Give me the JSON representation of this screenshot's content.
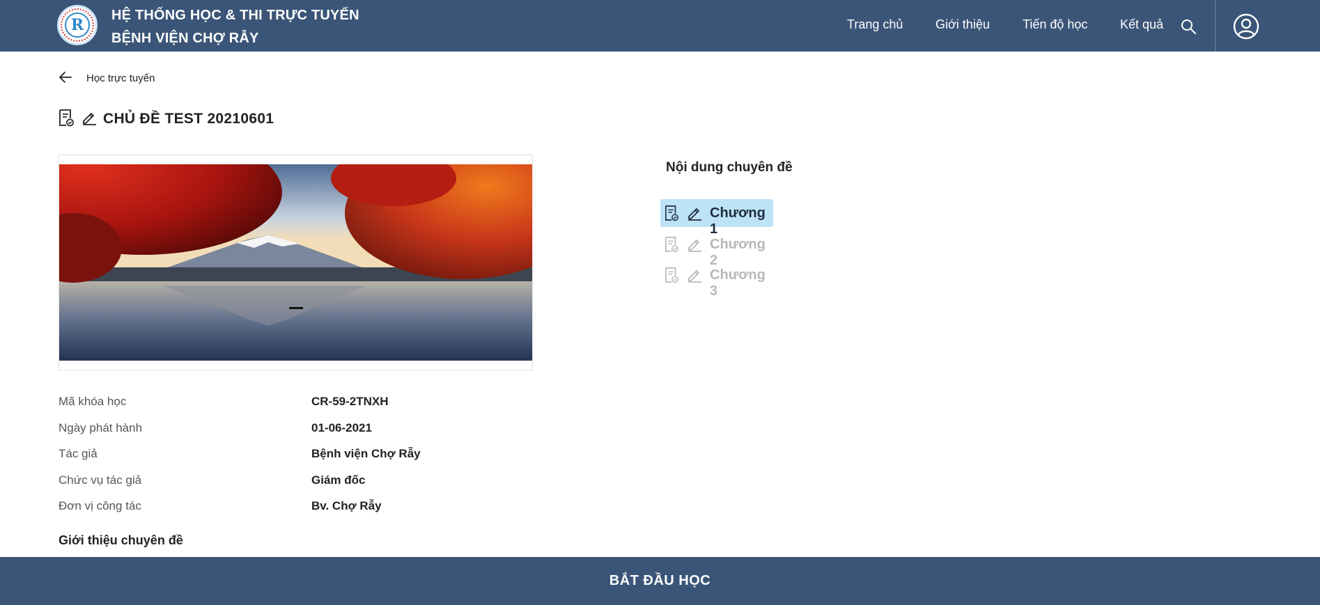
{
  "header": {
    "brand_line1": "HỆ THỐNG HỌC & THI TRỰC TUYẾN",
    "brand_line2": "BỆNH VIỆN CHỢ RẪY",
    "logo_letter": "R",
    "nav": [
      "Trang chủ",
      "Giới thiệu",
      "Tiến độ học",
      "Kết quả"
    ],
    "search_icon": "search-icon",
    "user_icon": "user-circle-icon"
  },
  "breadcrumb": {
    "label": "Học trực tuyến",
    "icon": "arrow-left-icon"
  },
  "course": {
    "title": "CHỦ ĐỀ TEST 20210601",
    "info": [
      {
        "label": "Mã khóa học",
        "value": "CR-59-2TNXH"
      },
      {
        "label": "Ngày phát hành",
        "value": "01-06-2021"
      },
      {
        "label": "Tác giả",
        "value": "Bệnh viện Chợ Rẫy"
      },
      {
        "label": "Chức vụ tác giả",
        "value": "Giám đốc"
      },
      {
        "label": "Đơn vị công tác",
        "value": "Bv. Chợ Rẫy"
      }
    ],
    "intro_heading": "Giới thiệu chuyên đề"
  },
  "content": {
    "heading": "Nội dung chuyên đề",
    "chapters": [
      {
        "label": "Chương 1",
        "state": "active"
      },
      {
        "label": "Chương 2",
        "state": "locked"
      },
      {
        "label": "Chương 3",
        "state": "locked"
      }
    ]
  },
  "footer": {
    "start_label": "BẮT ĐẦU HỌC"
  },
  "colors": {
    "header_bg": "#3a5577",
    "active_chapter_bg": "#bde3f7",
    "locked_text": "#b8b8b8"
  }
}
